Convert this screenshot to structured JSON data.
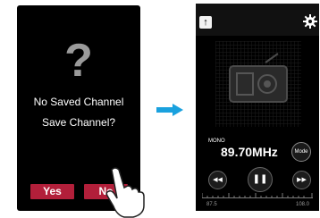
{
  "left_screen": {
    "icon": "question-mark",
    "question_glyph": "?",
    "message_line1": "No Saved Channel",
    "message_line2": "Save Channel?",
    "yes_label": "Yes",
    "no_label": "No"
  },
  "transition_icon": "arrow-right",
  "right_screen": {
    "back_label": "↑",
    "settings_icon": "gear-icon",
    "art_icon": "radio-icon",
    "audio_mode": "MONO",
    "frequency": "89.70MHz",
    "mode_label": "Mode",
    "prev_label": "◀◀",
    "play_pause_label": "❚❚",
    "next_label": "▶▶",
    "tuner_min": "87.5",
    "tuner_max": "108.0"
  },
  "colors": {
    "accent_red": "#b21f3a",
    "arrow_blue": "#1aa1de"
  }
}
